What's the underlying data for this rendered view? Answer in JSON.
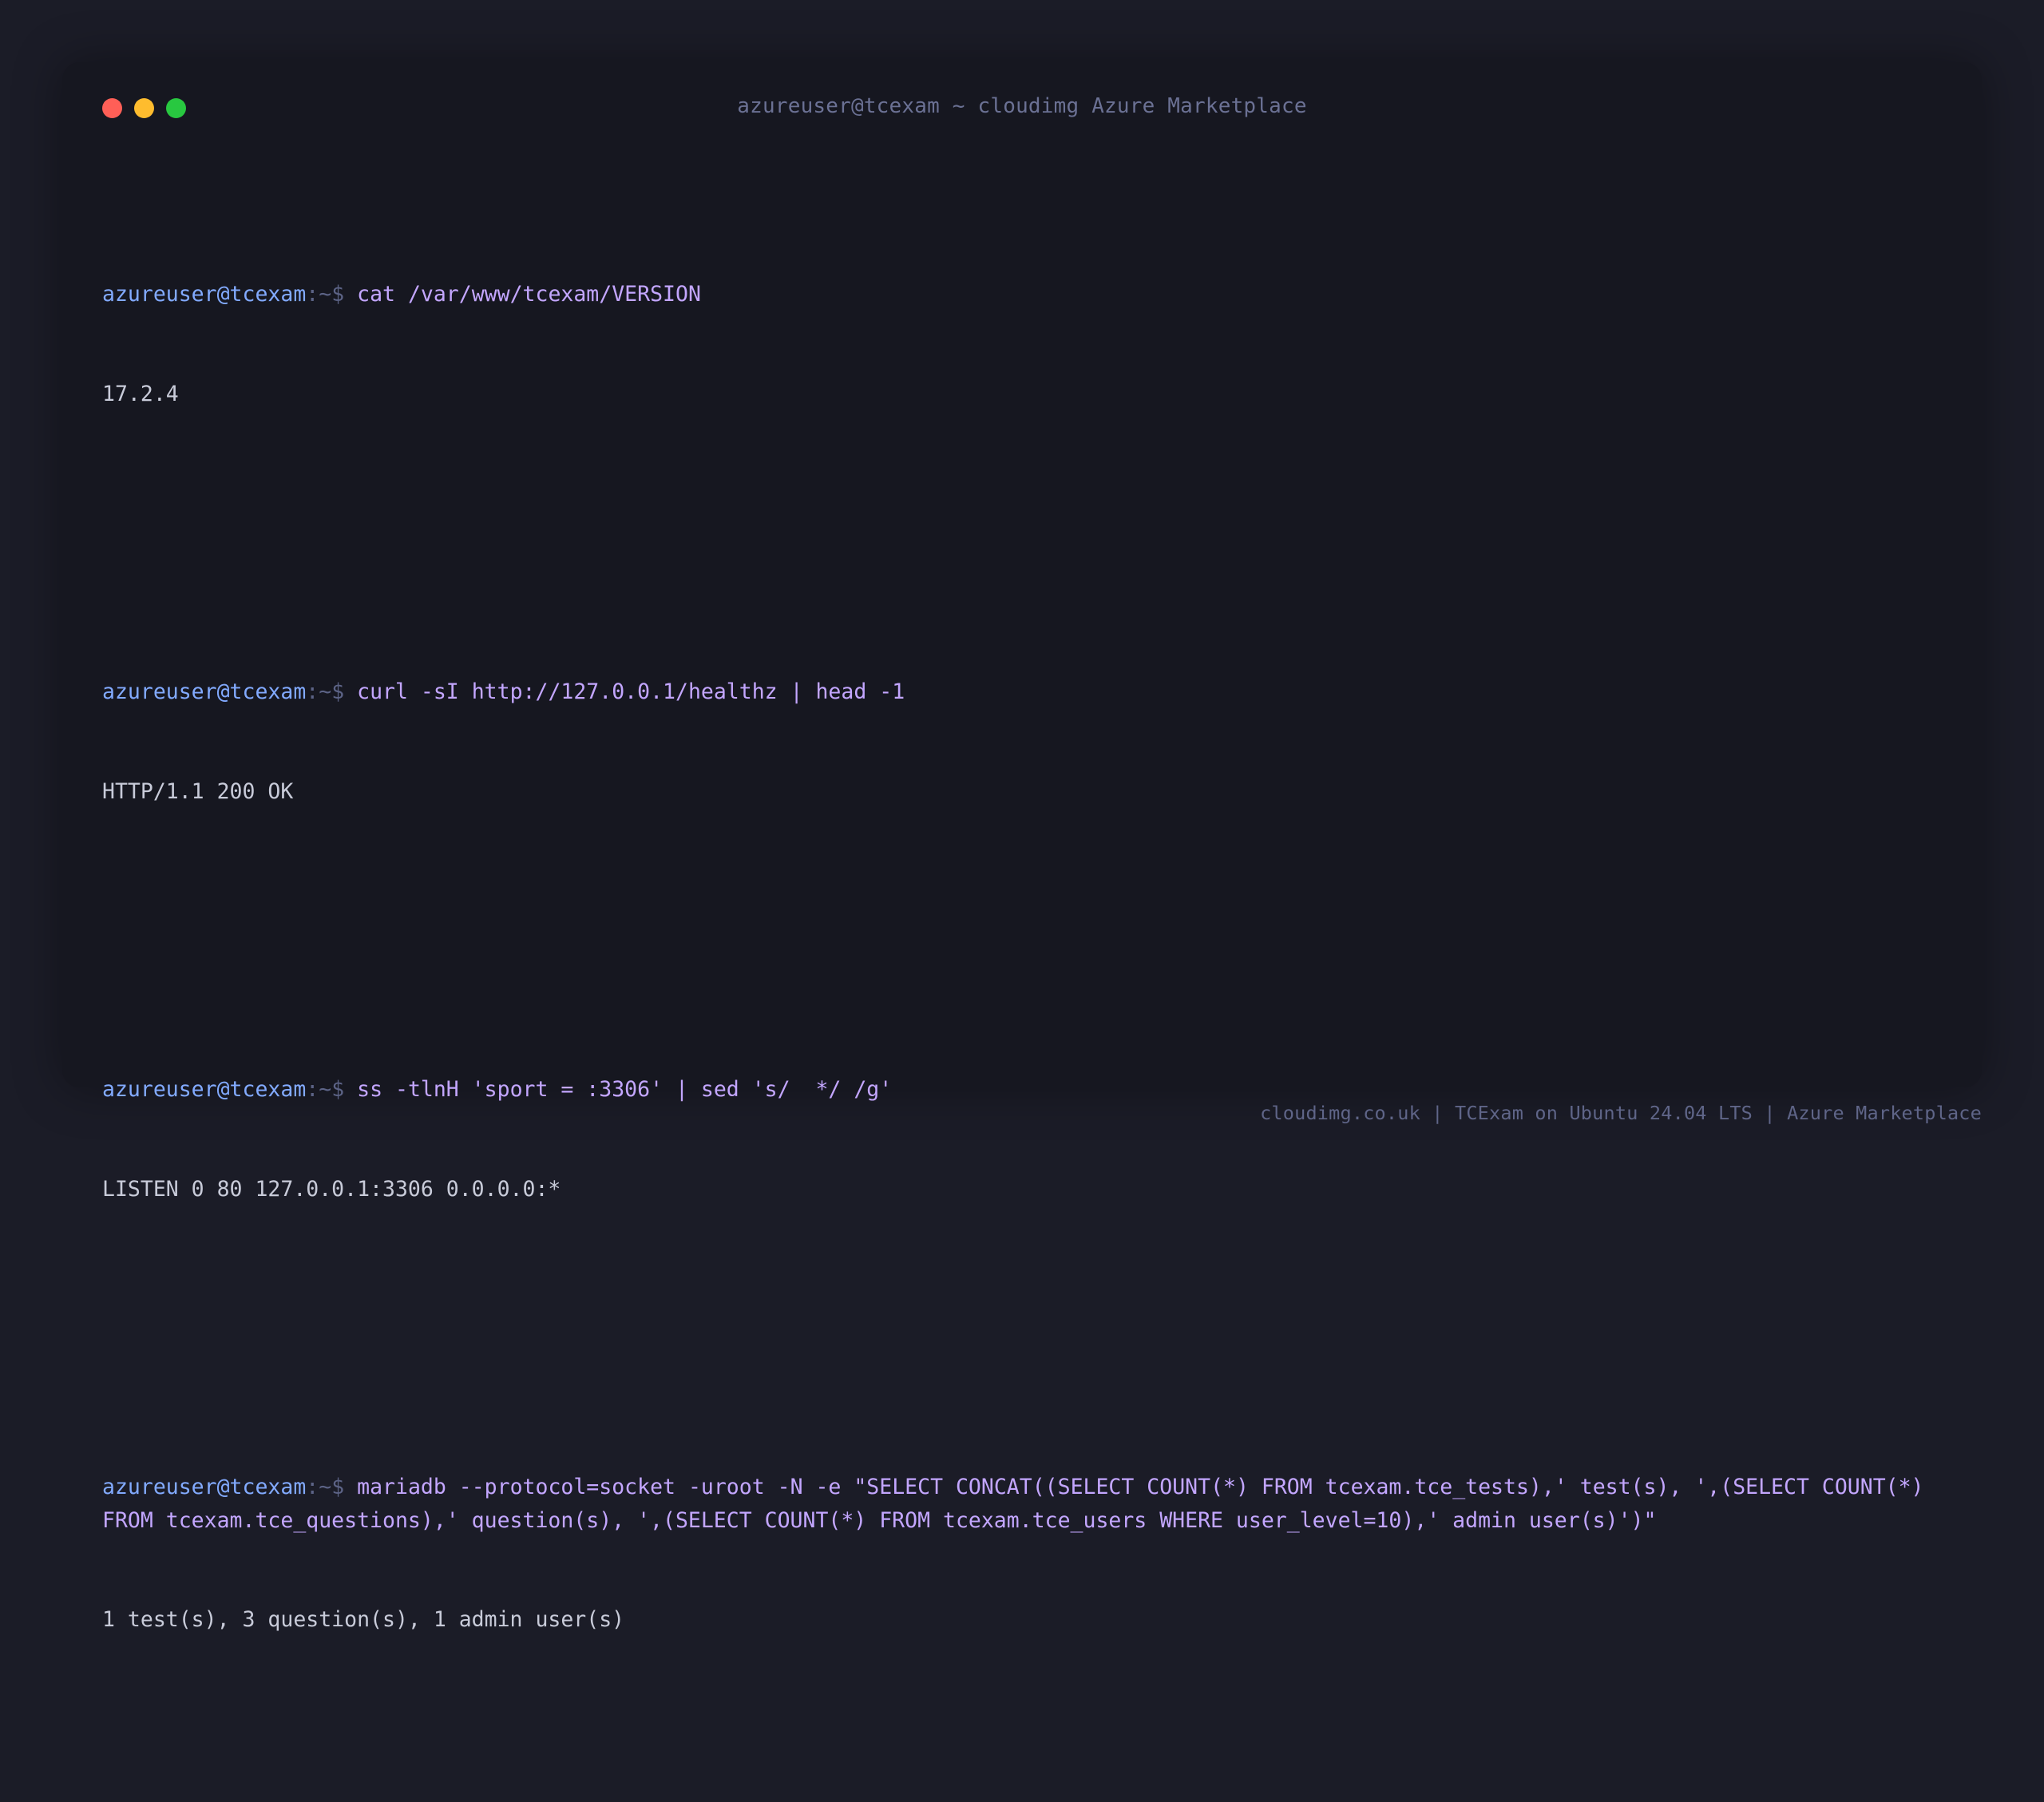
{
  "window": {
    "title": "azureuser@tcexam ~ cloudimg Azure Marketplace"
  },
  "prompt": {
    "user_host": "azureuser@tcexam",
    "path_symbol": ":~$"
  },
  "blocks": [
    {
      "command": "cat /var/www/tcexam/VERSION",
      "output": "17.2.4"
    },
    {
      "command": "curl -sI http://127.0.0.1/healthz | head -1",
      "output": "HTTP/1.1 200 OK"
    },
    {
      "command": "ss -tlnH 'sport = :3306' | sed 's/  */ /g'",
      "output": "LISTEN 0 80 127.0.0.1:3306 0.0.0.0:*"
    },
    {
      "command": "mariadb --protocol=socket -uroot -N -e \"SELECT CONCAT((SELECT COUNT(*) FROM tcexam.tce_tests),' test(s), ',(SELECT COUNT(*) FROM tcexam.tce_questions),' question(s), ',(SELECT COUNT(*) FROM tcexam.tce_users WHERE user_level=10),' admin user(s)')\"",
      "output": "1 test(s), 3 question(s), 1 admin user(s)"
    }
  ],
  "footer": {
    "text": "cloudimg.co.uk | TCExam on Ubuntu 24.04 LTS | Azure Marketplace"
  },
  "colors": {
    "background": "#1b1c27",
    "terminal": "#161720",
    "prompt_user": "#82aaff",
    "prompt_path": "#5c6386",
    "command": "#c3a6ff",
    "output": "#c8cbd9",
    "title": "#6b7194",
    "close": "#ff5f57",
    "minimize": "#febc2e",
    "maximize": "#28c840"
  },
  "icons": {
    "close": "close-icon",
    "minimize": "minimize-icon",
    "maximize": "maximize-icon"
  }
}
